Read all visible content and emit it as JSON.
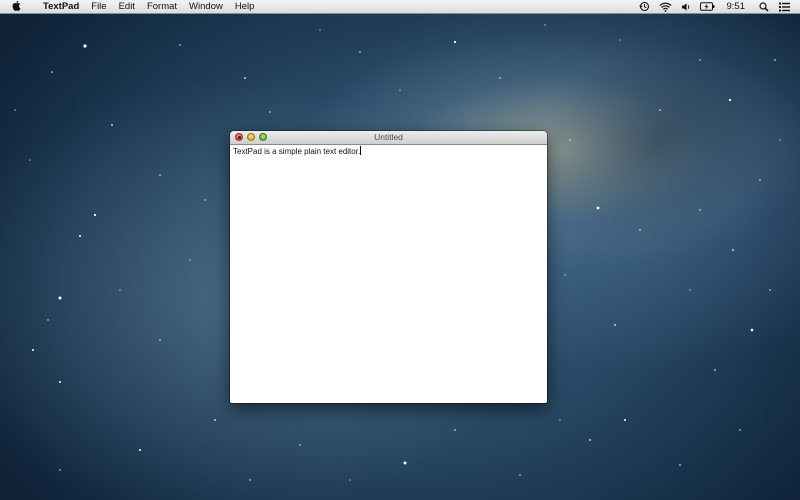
{
  "menubar": {
    "apple_icon": "apple-logo-icon",
    "app_name": "TextPad",
    "items": [
      "File",
      "Edit",
      "Format",
      "Window",
      "Help"
    ],
    "status_icons": [
      "time-machine-icon",
      "wifi-icon",
      "volume-icon",
      "battery-icon"
    ],
    "clock": "9:51",
    "right_icons": [
      "spotlight-search-icon",
      "notification-center-icon"
    ]
  },
  "window": {
    "title": "Untitled",
    "controls": [
      "close",
      "minimize",
      "zoom"
    ],
    "content": "TextPad is a simple plain text editor."
  }
}
